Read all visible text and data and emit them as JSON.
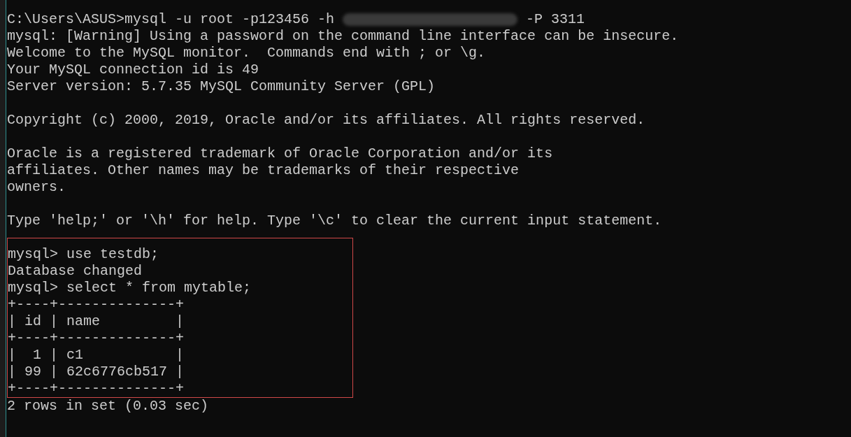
{
  "terminal": {
    "blocks": [
      {
        "kind": "redacted-line",
        "before": "C:\\Users\\ASUS>mysql -u root -p123456 -h ",
        "after": " -P 3311"
      },
      {
        "kind": "line",
        "text": "mysql: [Warning] Using a password on the command line interface can be insecure."
      },
      {
        "kind": "line",
        "text": "Welcome to the MySQL monitor.  Commands end with ; or \\g."
      },
      {
        "kind": "line",
        "text": "Your MySQL connection id is 49"
      },
      {
        "kind": "line",
        "text": "Server version: 5.7.35 MySQL Community Server (GPL)"
      },
      {
        "kind": "blank"
      },
      {
        "kind": "line",
        "text": "Copyright (c) 2000, 2019, Oracle and/or its affiliates. All rights reserved."
      },
      {
        "kind": "blank"
      },
      {
        "kind": "line",
        "text": "Oracle is a registered trademark of Oracle Corporation and/or its"
      },
      {
        "kind": "line",
        "text": "affiliates. Other names may be trademarks of their respective"
      },
      {
        "kind": "line",
        "text": "owners."
      },
      {
        "kind": "blank"
      },
      {
        "kind": "line",
        "text": "Type 'help;' or '\\h' for help. Type '\\c' to clear the current input statement."
      },
      {
        "kind": "blank"
      },
      {
        "kind": "highlight",
        "children": [
          {
            "kind": "line",
            "text": "mysql> use testdb;"
          },
          {
            "kind": "line",
            "text": "Database changed"
          },
          {
            "kind": "line",
            "text": "mysql> select * from mytable;"
          },
          {
            "kind": "line",
            "text": "+----+--------------+"
          },
          {
            "kind": "line",
            "text": "| id | name         |"
          },
          {
            "kind": "line",
            "text": "+----+--------------+"
          },
          {
            "kind": "line",
            "text": "|  1 | c1           |"
          },
          {
            "kind": "line",
            "text": "| 99 | 62c6776cb517 |"
          },
          {
            "kind": "line",
            "text": "+----+--------------+"
          }
        ]
      },
      {
        "kind": "line",
        "text": "2 rows in set (0.03 sec)"
      }
    ]
  }
}
